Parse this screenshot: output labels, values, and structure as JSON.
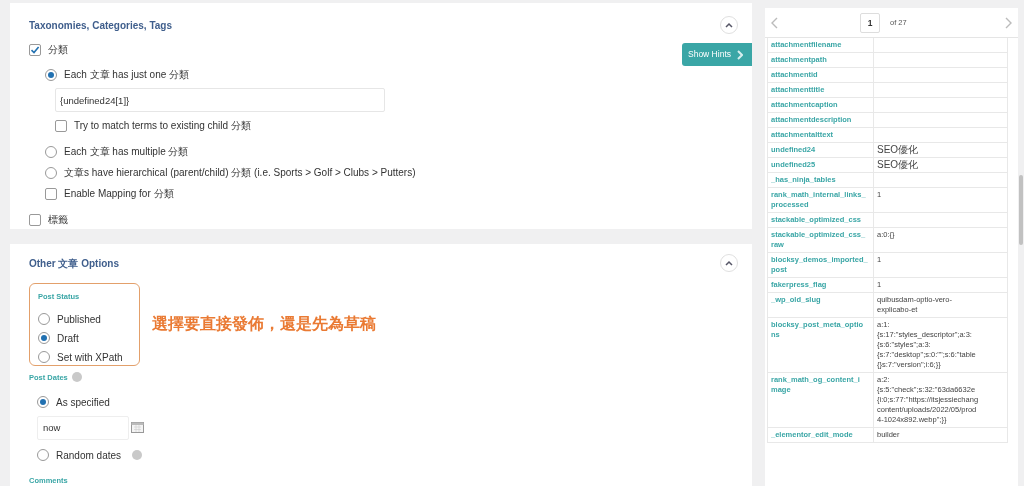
{
  "taxonomies_panel": {
    "title": "Taxonomies, Categories, Tags",
    "show_hints_button": "Show Hints",
    "taxonomies": [
      {
        "label": "分類",
        "checked": true,
        "options": [
          {
            "kind": "radio",
            "label": "Each 文章 has just one 分類",
            "selected": true,
            "field_value": "{undefined24[1]}",
            "sub_checkbox": {
              "label": "Try to match terms to existing child 分類",
              "checked": false
            }
          },
          {
            "kind": "radio",
            "label": "Each 文章 has multiple 分類",
            "selected": false
          },
          {
            "kind": "radio",
            "label": "文章s have hierarchical (parent/child) 分類 (i.e. Sports > Golf > Clubs > Putters)",
            "selected": false
          },
          {
            "kind": "checkbox",
            "label": "Enable Mapping for 分類",
            "checked": false
          }
        ]
      },
      {
        "label": "標籤",
        "checked": false
      }
    ]
  },
  "other_panel": {
    "title": "Other 文章 Options",
    "post_status": {
      "label": "Post Status",
      "options": [
        {
          "label": "Published",
          "selected": false
        },
        {
          "label": "Draft",
          "selected": true
        },
        {
          "label": "Set with XPath",
          "selected": false
        }
      ]
    },
    "annotation": "選擇要直接發佈，還是先為草稿",
    "post_dates": {
      "label": "Post Dates",
      "options": [
        {
          "label": "As specified",
          "selected": true,
          "field_value": "now"
        },
        {
          "label": "Random dates",
          "selected": false,
          "help": true
        }
      ]
    },
    "comments_label": "Comments"
  },
  "preview": {
    "page": "1",
    "of": "of 27",
    "rows": [
      {
        "key": [
          "attachmentfilename"
        ],
        "value": []
      },
      {
        "key": [
          "attachmentpath"
        ],
        "value": []
      },
      {
        "key": [
          "attachmentid"
        ],
        "value": []
      },
      {
        "key": [
          "attachmenttitle"
        ],
        "value": []
      },
      {
        "key": [
          "attachmentcaption"
        ],
        "value": []
      },
      {
        "key": [
          "attachmentdescription"
        ],
        "value": []
      },
      {
        "key": [
          "attachmentalttext"
        ],
        "value": []
      },
      {
        "key": [
          "undefined24"
        ],
        "value": [
          "SEO優化"
        ]
      },
      {
        "key": [
          "undefined25"
        ],
        "value": [
          "SEO優化"
        ]
      },
      {
        "key": [
          "_has_ninja_tables"
        ],
        "value": []
      },
      {
        "key": [
          "rank_math_internal_links_",
          "processed"
        ],
        "value": [
          "1"
        ]
      },
      {
        "key": [
          "stackable_optimized_css"
        ],
        "value": []
      },
      {
        "key": [
          "stackable_optimized_css_",
          "raw"
        ],
        "value": [
          "a:0:{}"
        ]
      },
      {
        "key": [
          "blocksy_demos_imported_",
          "post"
        ],
        "value": [
          "1"
        ]
      },
      {
        "key": [
          "fakerpress_flag"
        ],
        "value": [
          "1"
        ]
      },
      {
        "key": [
          "_wp_old_slug"
        ],
        "value": [
          "quibusdam-optio-vero-",
          "explicabo-et"
        ]
      },
      {
        "key": [
          "blocksy_post_meta_optio",
          "ns"
        ],
        "value": [
          "a:1:",
          "{s:17:\"styles_descriptor\";a:3:",
          "{s:6:\"styles\";a:3:",
          "{s:7:\"desktop\";s:0:\"\";s:6:\"table",
          "{}s:7:\"version\";i:6;}}"
        ]
      },
      {
        "key": [
          "rank_math_og_content_i",
          "mage"
        ],
        "value": [
          "a:2:",
          "{s:5:\"check\";s:32:\"63da6632e",
          "{i:0;s:77:\"https://itsjessiechang",
          "content/uploads/2022/05/prod",
          "4-1024x892.webp\";}}"
        ]
      },
      {
        "key": [
          "_elementor_edit_mode"
        ],
        "value": [
          "builder"
        ]
      }
    ]
  }
}
